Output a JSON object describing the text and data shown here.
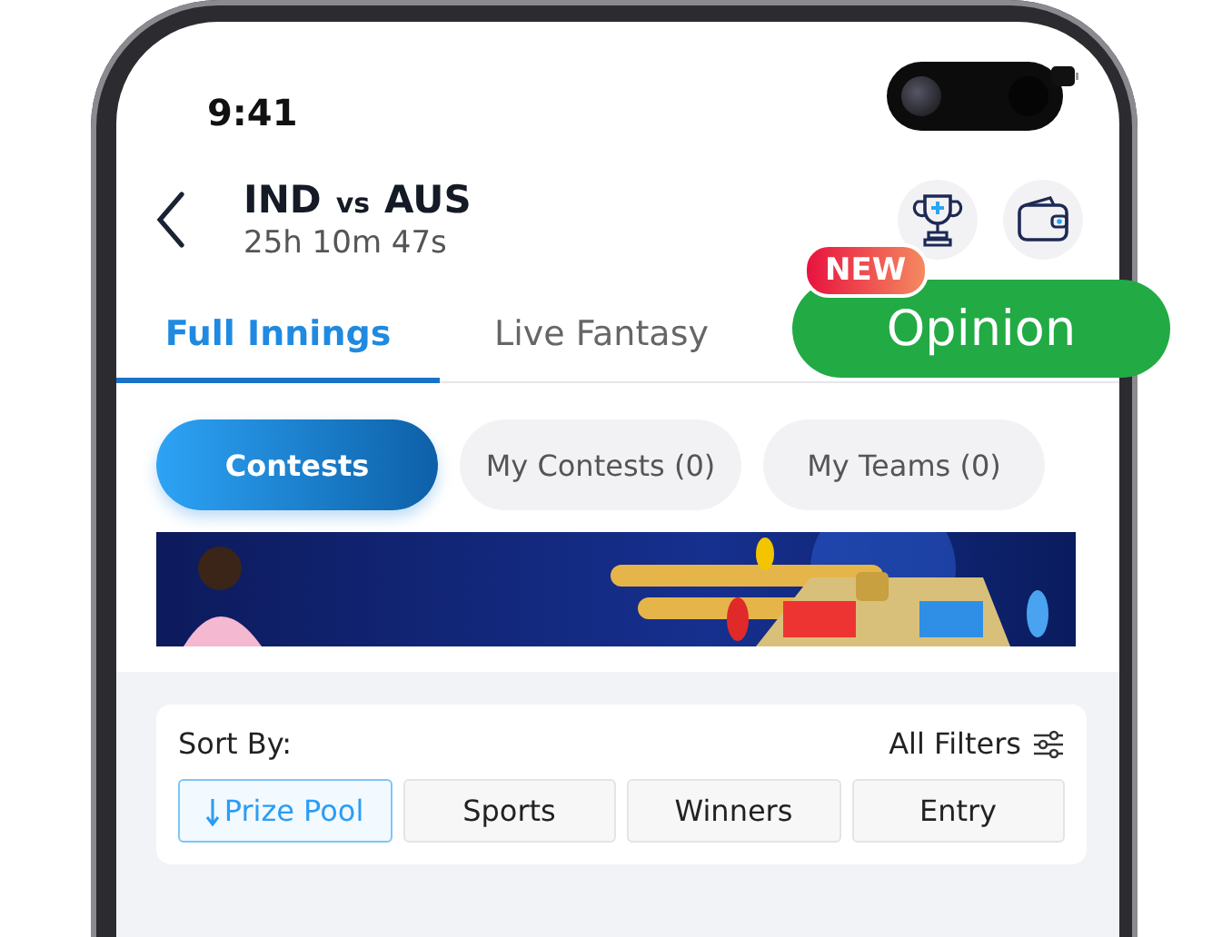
{
  "status_bar": {
    "time": "9:41"
  },
  "header": {
    "title_left": "IND",
    "title_vs": "vs",
    "title_right": "AUS",
    "countdown": "25h 10m 47s"
  },
  "tabs": [
    {
      "label": "Full Innings",
      "selected": true,
      "kind": "tab"
    },
    {
      "label": "Live Fantasy",
      "selected": false,
      "kind": "tab"
    },
    {
      "label": "Opinion",
      "selected": false,
      "kind": "promo",
      "badge": "NEW"
    }
  ],
  "segments": [
    {
      "label": "Contests",
      "selected": true
    },
    {
      "label": "My Contests (0)",
      "selected": false
    },
    {
      "label": "My Teams (0)",
      "selected": false
    }
  ],
  "sort": {
    "label": "Sort By:",
    "filters_label": "All Filters",
    "options": [
      {
        "label": "Prize Pool",
        "selected": true
      },
      {
        "label": "Sports",
        "selected": false
      },
      {
        "label": "Winners",
        "selected": false
      },
      {
        "label": "Entry",
        "selected": false
      }
    ]
  }
}
